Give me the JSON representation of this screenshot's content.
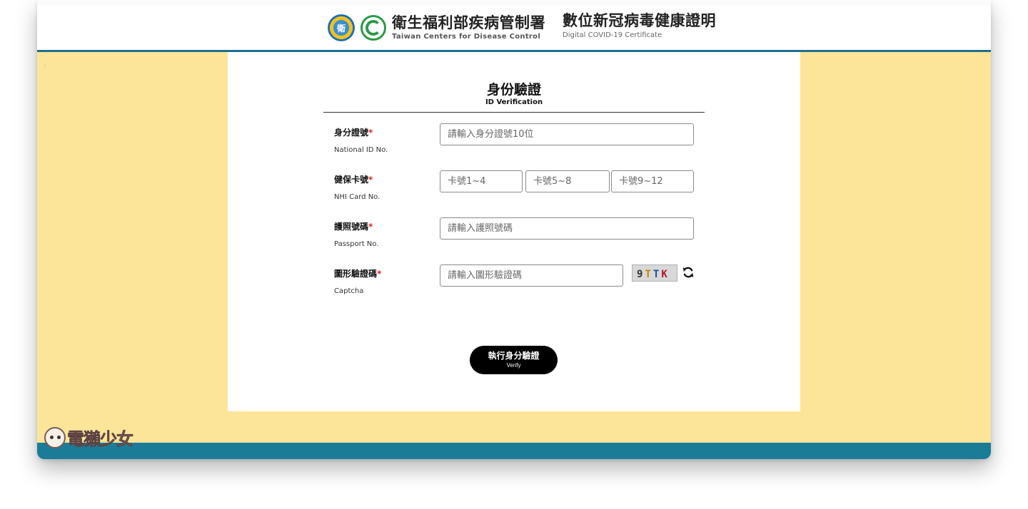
{
  "header": {
    "org_cn": "衛生福利部疾病管制署",
    "org_en": "Taiwan Centers for Disease Control",
    "cert_cn": "數位新冠病毒健康證明",
    "cert_en": "Digital COVID-19 Certificate"
  },
  "form": {
    "title_cn": "身份驗證",
    "title_en": "ID Verification",
    "national_id": {
      "label_cn": "身分證號",
      "label_en": "National ID No.",
      "required_mark": "*",
      "placeholder": "請輸入身分證號10位"
    },
    "nhi_card": {
      "label_cn": "健保卡號",
      "label_en": "NHI Card No.",
      "required_mark": "*",
      "placeholder_1": "卡號1~4",
      "placeholder_2": "卡號5~8",
      "placeholder_3": "卡號9~12"
    },
    "passport": {
      "label_cn": "護照號碼",
      "label_en": "Passport No.",
      "required_mark": "*",
      "placeholder": "請輸入護照號碼"
    },
    "captcha": {
      "label_cn": "圖形驗證碼",
      "label_en": "Captcha",
      "required_mark": "*",
      "placeholder": "請輸入圖形驗證碼",
      "chars": [
        "9",
        "T",
        "T",
        "K"
      ]
    },
    "verify_button": {
      "label_cn": "執行身分驗證",
      "label_en": "Verify"
    }
  },
  "watermark": {
    "text": "電獺少女"
  },
  "colors": {
    "header_bar": "#1c6f8c",
    "page_bg": "#fce599",
    "bottom_bar": "#1b7c98",
    "required": "#dd2222",
    "button": "#000000"
  }
}
